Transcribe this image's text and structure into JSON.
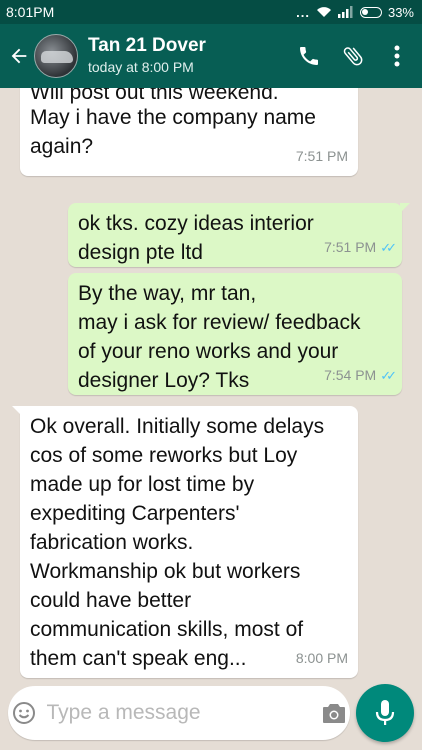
{
  "status_bar": {
    "time": "8:01PM",
    "dots": "...",
    "battery": "33%"
  },
  "header": {
    "contact_name": "Tan 21 Dover",
    "last_seen": "today at 8:00 PM"
  },
  "messages": [
    {
      "direction": "incoming",
      "lines": [
        "Will post out this weekend.",
        "",
        "May i have the company name",
        "again?"
      ],
      "time": "7:51 PM"
    },
    {
      "direction": "outgoing",
      "lines": [
        "ok tks. cozy ideas interior",
        "design pte ltd"
      ],
      "time": "7:51 PM",
      "status": "read"
    },
    {
      "direction": "outgoing",
      "lines": [
        "By the way, mr tan,",
        "may i ask for review/ feedback",
        "of your reno works and your",
        "designer Loy? Tks"
      ],
      "time": "7:54 PM",
      "status": "read"
    },
    {
      "direction": "incoming",
      "lines": [
        "Ok overall. Initially some delays",
        "cos of some reworks but Loy",
        "made up for lost time by",
        "expediting Carpenters'",
        "fabrication works.",
        "Workmanship ok but workers",
        "could have better",
        "communication skills, most of",
        "them can't speak eng..."
      ],
      "time": "8:00 PM"
    }
  ],
  "composer": {
    "placeholder": "Type a message"
  },
  "colors": {
    "header": "#075e54",
    "status_bar": "#054d44",
    "outgoing_bubble": "#dcf8c6",
    "incoming_bubble": "#ffffff",
    "read_ticks": "#4fc3f7",
    "mic_button": "#00897b"
  },
  "icons": [
    "back-arrow-icon",
    "phone-icon",
    "attach-icon",
    "more-vert-icon",
    "emoji-icon",
    "camera-icon",
    "mic-icon",
    "wifi-icon",
    "signal-icon",
    "battery-icon"
  ]
}
